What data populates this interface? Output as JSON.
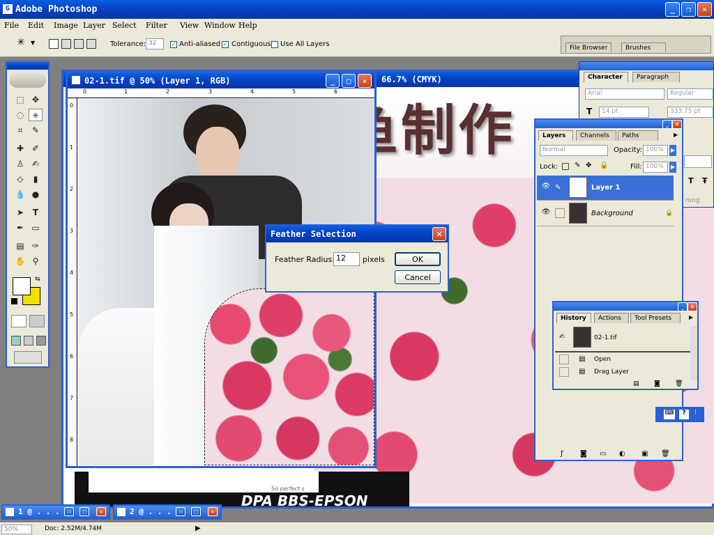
{
  "app": {
    "title": "Adobe Photoshop"
  },
  "menu": [
    "File",
    "Edit",
    "Image",
    "Layer",
    "Select",
    "Filter",
    "View",
    "Window",
    "Help"
  ],
  "options": {
    "tolerance_label": "Tolerance:",
    "tolerance_value": "32",
    "anti_aliased": "Anti-aliased",
    "contiguous": "Contiguous",
    "use_all_layers": "Use All Layers",
    "anti_aliased_checked": true,
    "contiguous_checked": true,
    "use_all_layers_checked": false
  },
  "well_tabs": [
    "File Browser",
    "Brushes"
  ],
  "doc_front": {
    "title": "02-1.tif @ 50% (Layer 1, RGB)"
  },
  "doc_back": {
    "title_partial": "66.7% (CMYK)",
    "watermark": "乌鱼制作",
    "footer": "DPA BBS-EPSON",
    "script_text": "So perfect s"
  },
  "ruler_h": [
    "0",
    "1",
    "2",
    "3",
    "4",
    "5",
    "6"
  ],
  "ruler_v": [
    "0",
    "1",
    "2",
    "3",
    "4",
    "5",
    "6",
    "7",
    "8"
  ],
  "dialog": {
    "title": "Feather Selection",
    "label": "Feather Radius:",
    "value": "12",
    "unit": "pixels",
    "ok": "OK",
    "cancel": "Cancel"
  },
  "character": {
    "tabs": [
      "Character",
      "Paragraph"
    ],
    "font": "Arial",
    "style": "Regular",
    "size": "14 pt",
    "leading": "333.75 pt",
    "partial_text": "rong"
  },
  "layers": {
    "tabs": [
      "Layers",
      "Channels",
      "Paths"
    ],
    "blend": "Normal",
    "opacity_label": "Opacity:",
    "opacity": "100%",
    "lock_label": "Lock:",
    "fill_label": "Fill:",
    "fill": "100%",
    "items": [
      {
        "name": "Layer 1",
        "selected": true
      },
      {
        "name": "Background",
        "selected": false
      }
    ]
  },
  "history": {
    "tabs": [
      "History",
      "Actions",
      "Tool Presets"
    ],
    "snapshot": "02-1.tif",
    "items": [
      "Open",
      "Drag Layer"
    ]
  },
  "status": {
    "zoom": "50%",
    "doc": "Doc: 2.52M/4.74M"
  },
  "minimized": [
    {
      "label": "1 @ . . ."
    },
    {
      "label": "2 @ . . ."
    }
  ],
  "colors": {
    "accent": "#2a5fd8",
    "title_gradient_top": "#0a5fe0",
    "background_color": "#f0e000",
    "watermark": "#5a2f2f"
  }
}
